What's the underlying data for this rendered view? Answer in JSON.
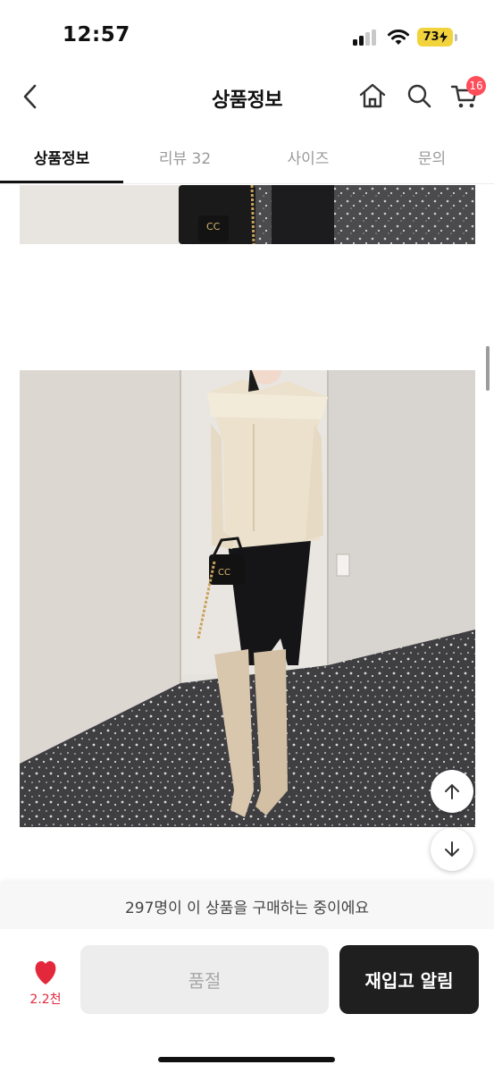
{
  "status_bar": {
    "time": "12:57",
    "battery": "73"
  },
  "header": {
    "title": "상품정보",
    "cart_count": "16"
  },
  "tabs": [
    {
      "label": "상품정보",
      "active": true
    },
    {
      "label": "리뷰 32",
      "active": false
    },
    {
      "label": "사이즈",
      "active": false
    },
    {
      "label": "문의",
      "active": false
    }
  ],
  "icons": [
    "back-arrow-icon",
    "home-icon",
    "search-icon",
    "cart-icon",
    "arrow-up-icon",
    "arrow-down-icon",
    "heart-icon"
  ],
  "bottom": {
    "notice": "297명이 이 상품을 구매하는 중이에요",
    "like_count": "2.2천",
    "soldout_label": "품절",
    "restock_label": "재입고 알림"
  },
  "colors": {
    "accent_red": "#e3283c",
    "badge": "#ff4d5a",
    "primary_button": "#1f1f1f",
    "battery": "#f2d33c"
  }
}
